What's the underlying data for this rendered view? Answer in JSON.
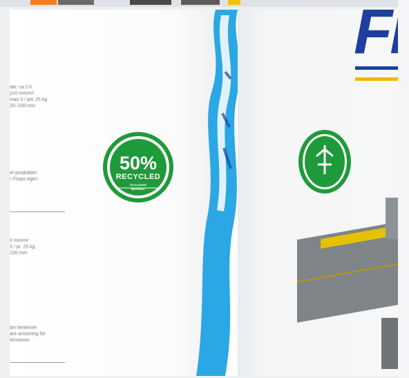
{
  "seal": {
    "percent": "50%",
    "recycled": "RECYCLED",
    "material_line1": "PACKAGING",
    "material_line2": "MATERIAL"
  },
  "brand": {
    "text": "FI"
  },
  "side_text": {
    "block1": "ide: ca 2 h\ny10 mm/m²\nmax 3 / per 25 kg\n20–100 mm",
    "block2": "er produkten\nr Finjas egen",
    "block3": "0 mm/m²\n3 / pr. 25 kg\n100 mm",
    "block4": "bin beskriver\nare anvisning for\nAnvisnon"
  },
  "colors": {
    "seal_green": "#1f9a3a",
    "brand_blue": "#1f3f9e",
    "handle_blue": "#2aa7e4",
    "handle_yellow": "#f2b705"
  }
}
